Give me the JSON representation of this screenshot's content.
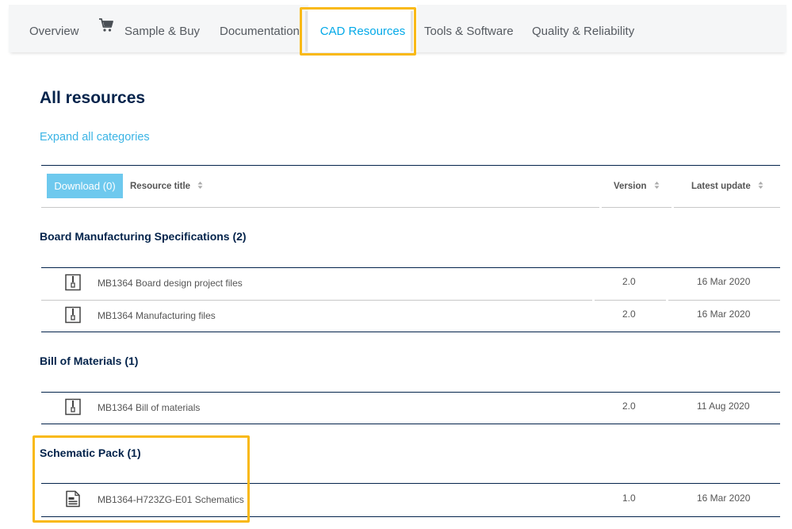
{
  "nav": {
    "tabs": [
      {
        "label": "Overview"
      },
      {
        "label": "Sample & Buy",
        "icon": "cart-icon"
      },
      {
        "label": "Documentation"
      },
      {
        "label": "CAD Resources",
        "active": true
      },
      {
        "label": "Tools & Software"
      },
      {
        "label": "Quality & Reliability"
      }
    ]
  },
  "page": {
    "title": "All resources",
    "expand_link": "Expand all categories"
  },
  "table": {
    "download_label": "Download (0)",
    "columns": {
      "title": "Resource title",
      "version": "Version",
      "updated": "Latest update"
    }
  },
  "categories": [
    {
      "title": "Board Manufacturing Specifications (2)",
      "rows": [
        {
          "title": "MB1364 Board design project files",
          "version": "2.0",
          "updated": "16 Mar 2020",
          "icon": "zip-file-icon"
        },
        {
          "title": "MB1364 Manufacturing files",
          "version": "2.0",
          "updated": "16 Mar 2020",
          "icon": "zip-file-icon"
        }
      ]
    },
    {
      "title": "Bill of Materials (1)",
      "rows": [
        {
          "title": "MB1364 Bill of materials",
          "version": "2.0",
          "updated": "11 Aug 2020",
          "icon": "zip-file-icon"
        }
      ]
    },
    {
      "title": "Schematic Pack (1)",
      "rows": [
        {
          "title": "MB1364-H723ZG-E01 Schematics",
          "version": "1.0",
          "updated": "16 Mar 2020",
          "icon": "document-icon"
        }
      ]
    }
  ],
  "colors": {
    "accent": "#03a9e8",
    "highlight": "#f9b916",
    "navy": "#03234b",
    "download_bg": "#6ec9ee"
  }
}
